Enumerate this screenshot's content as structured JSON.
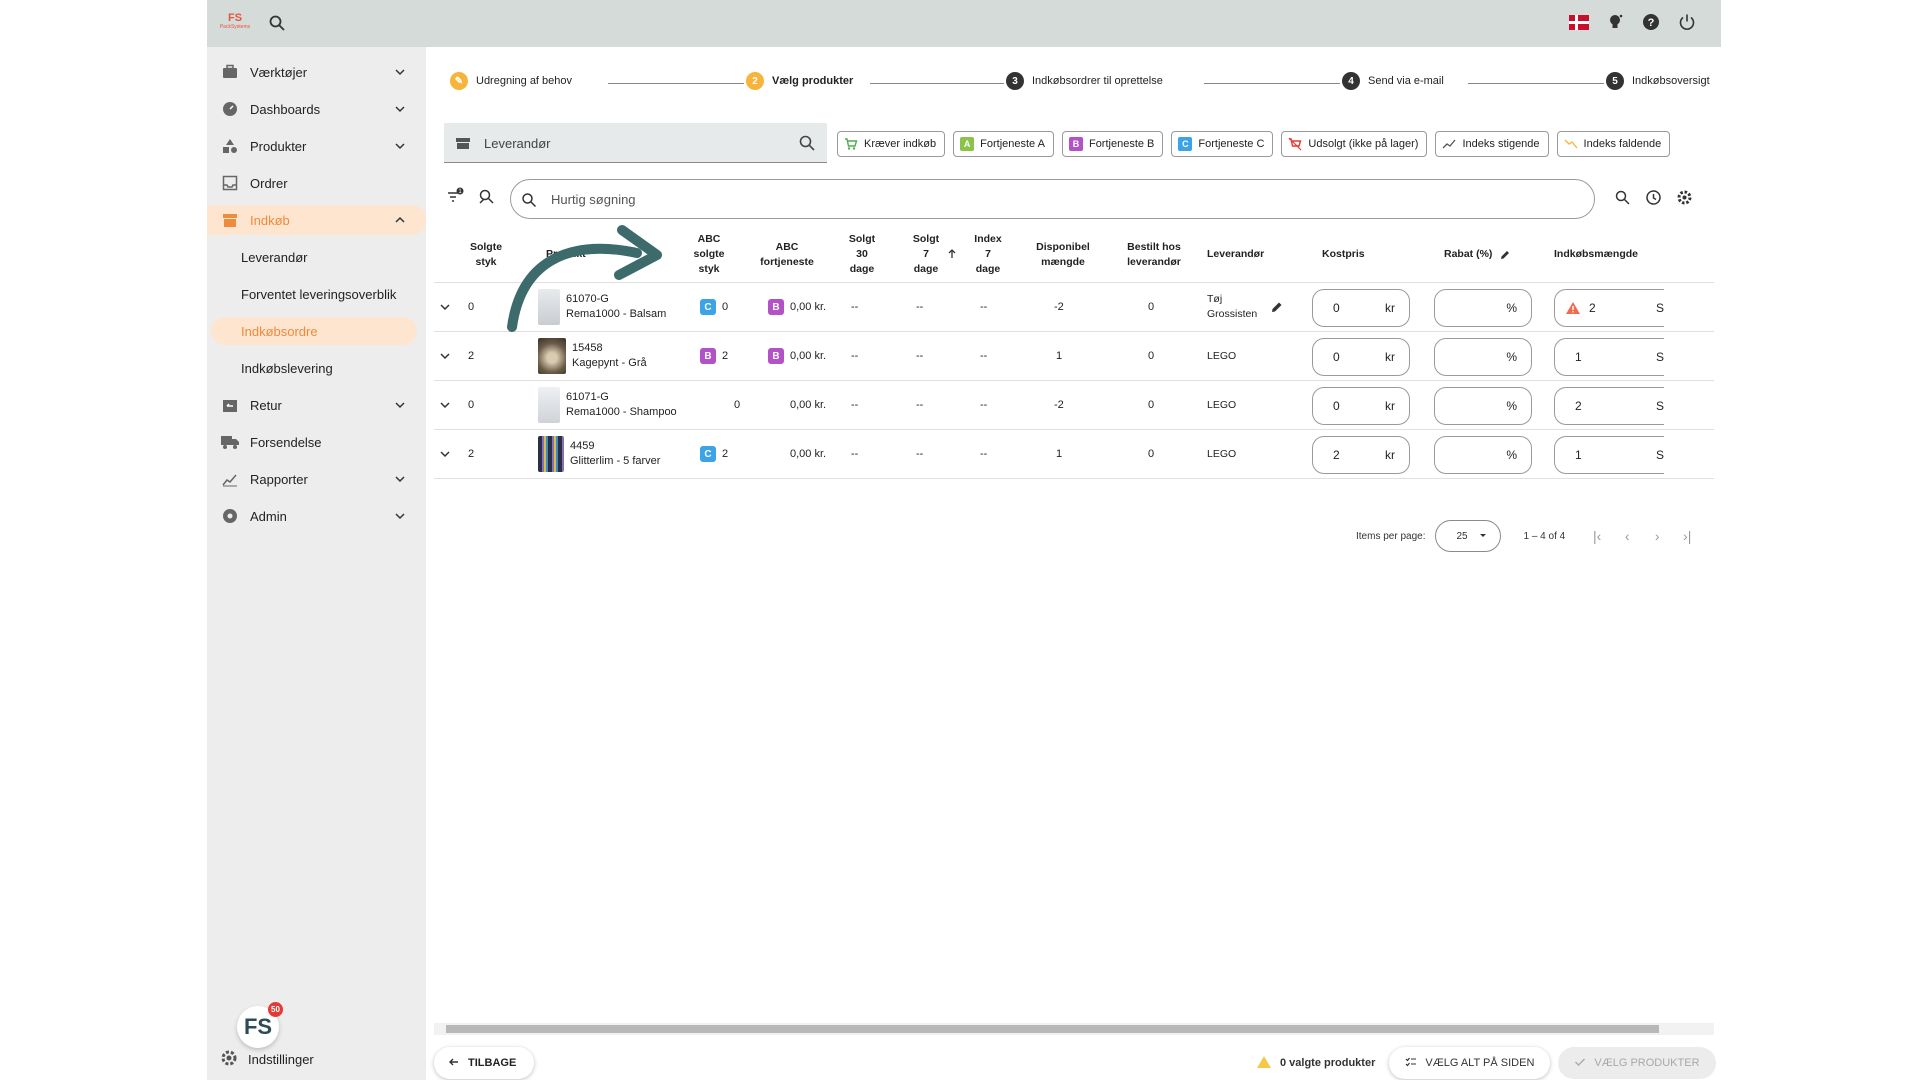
{
  "sidebar": {
    "items": [
      {
        "label": "Værktøjer",
        "icon": "toolbox-icon"
      },
      {
        "label": "Dashboards",
        "icon": "gauge-icon"
      },
      {
        "label": "Produkter",
        "icon": "shapes-icon"
      },
      {
        "label": "Ordrer",
        "icon": "inbox-icon"
      },
      {
        "label": "Indkøb",
        "icon": "store-icon"
      },
      {
        "label": "Retur",
        "icon": "return-icon"
      },
      {
        "label": "Forsendelse",
        "icon": "truck-icon"
      },
      {
        "label": "Rapporter",
        "icon": "chart-icon"
      },
      {
        "label": "Admin",
        "icon": "admin-icon"
      }
    ],
    "subitems": [
      "Leverandør",
      "Forventet leveringsoverblik",
      "Indkøbsordre",
      "Indkøbslevering"
    ],
    "settings_label": "Indstillinger",
    "badge_logo": "FS",
    "badge_count": "50"
  },
  "stepper": {
    "steps": [
      {
        "num": "✎",
        "label": "Udregning af behov"
      },
      {
        "num": "2",
        "label": "Vælg produkter"
      },
      {
        "num": "3",
        "label": "Indkøbsordrer til oprettelse"
      },
      {
        "num": "4",
        "label": "Send via e-mail"
      },
      {
        "num": "5",
        "label": "Indkøbsoversigt"
      }
    ]
  },
  "supplier_label": "Leverandør",
  "filters": [
    {
      "label": "Kræver indkøb",
      "icon": "cart-icon",
      "tag": "",
      "color": "#4caf50"
    },
    {
      "label": "Fortjeneste A",
      "icon": "grade-a-icon",
      "tag": "A",
      "color": "#8bc34a"
    },
    {
      "label": "Fortjeneste B",
      "icon": "grade-b-icon",
      "tag": "B",
      "color": "#b252c6"
    },
    {
      "label": "Fortjeneste C",
      "icon": "grade-c-icon",
      "tag": "C",
      "color": "#3ba3e6"
    },
    {
      "label": "Udsolgt (ikke på lager)",
      "icon": "cart-off-icon",
      "tag": "",
      "color": "#e53935"
    },
    {
      "label": "Indeks stigende",
      "icon": "trend-up-icon",
      "tag": "",
      "color": "#555"
    },
    {
      "label": "Indeks faldende",
      "icon": "trend-down-icon",
      "tag": "",
      "color": "#f6b43a"
    }
  ],
  "search_placeholder": "Hurtig søgning",
  "table": {
    "headers": [
      "Solgte\nstyk",
      "Produkt",
      "ABC\nsolgte\nstyk",
      "ABC\nfortjeneste",
      "Solgt\n30\ndage",
      "Solgt\n7\ndage",
      "Index\n7\ndage",
      "Disponibel\nmængde",
      "Bestilt hos\nleverandør",
      "Leverandør",
      "Kostpris",
      "Rabat (%)",
      "Indkøbsmængde"
    ],
    "rows": [
      {
        "solgte": "0",
        "sku": "61070-G",
        "name": "Rema1000 - Balsam",
        "abc_solgte_grade": "C",
        "abc_solgte_val": "0",
        "abc_fortj_grade": "B",
        "abc_fortj_val": "0,00 kr.",
        "s30": "--",
        "s7": "--",
        "idx": "--",
        "disp": "-2",
        "bestilt": "0",
        "lev": "Tøj\nGrossisten",
        "kost": "0",
        "kost_unit": "kr",
        "rabat_unit": "%",
        "maengde": "2",
        "maengde_unit": "S",
        "warn": true
      },
      {
        "solgte": "2",
        "sku": "15458",
        "name": "Kagepynt - Grå",
        "abc_solgte_grade": "B",
        "abc_solgte_val": "2",
        "abc_fortj_grade": "B",
        "abc_fortj_val": "0,00 kr.",
        "s30": "--",
        "s7": "--",
        "idx": "--",
        "disp": "1",
        "bestilt": "0",
        "lev": "LEGO",
        "kost": "0",
        "kost_unit": "kr",
        "rabat_unit": "%",
        "maengde": "1",
        "maengde_unit": "S",
        "warn": false
      },
      {
        "solgte": "0",
        "sku": "61071-G",
        "name": "Rema1000 - Shampoo",
        "abc_solgte_grade": "",
        "abc_solgte_val": "0",
        "abc_fortj_grade": "",
        "abc_fortj_val": "0,00 kr.",
        "s30": "--",
        "s7": "--",
        "idx": "--",
        "disp": "-2",
        "bestilt": "0",
        "lev": "LEGO",
        "kost": "0",
        "kost_unit": "kr",
        "rabat_unit": "%",
        "maengde": "2",
        "maengde_unit": "S",
        "warn": false
      },
      {
        "solgte": "2",
        "sku": "4459",
        "name": "Glitterlim - 5 farver",
        "abc_solgte_grade": "C",
        "abc_solgte_val": "2",
        "abc_fortj_grade": "",
        "abc_fortj_val": "0,00 kr.",
        "s30": "--",
        "s7": "--",
        "idx": "--",
        "disp": "1",
        "bestilt": "0",
        "lev": "LEGO",
        "kost": "2",
        "kost_unit": "kr",
        "rabat_unit": "%",
        "maengde": "1",
        "maengde_unit": "S",
        "warn": false
      }
    ]
  },
  "pager": {
    "label": "Items per page:",
    "value": "25",
    "range": "1 – 4 of 4"
  },
  "footer": {
    "back": "TILBAGE",
    "selected": "0 valgte produkter",
    "select_all": "VÆLG ALT PÅ SIDEN",
    "select_products": "VÆLG PRODUKTER"
  },
  "colors": {
    "accent": "#f08a3c",
    "accent_bg": "#fde5d0",
    "topbar": "#d5dbd9",
    "arrow": "#3d6b6b"
  }
}
